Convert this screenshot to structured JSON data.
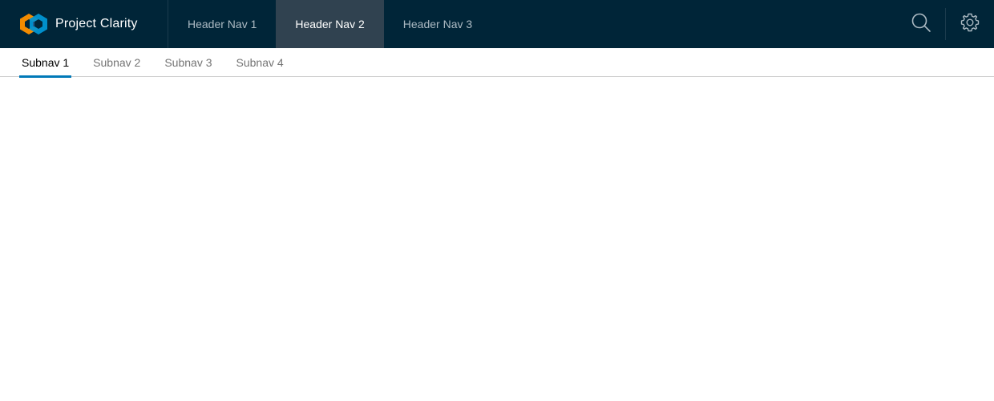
{
  "header": {
    "brand_title": "Project Clarity",
    "nav": [
      {
        "label": "Header Nav 1",
        "active": false
      },
      {
        "label": "Header Nav 2",
        "active": true
      },
      {
        "label": "Header Nav 3",
        "active": false
      }
    ],
    "actions": {
      "search_icon": "search-icon",
      "settings_icon": "gear-icon"
    },
    "colors": {
      "background": "#002538",
      "active_tab": "#304250",
      "logo_orange": "#f38b00",
      "logo_blue": "#0095d3"
    }
  },
  "subnav": {
    "tabs": [
      {
        "label": "Subnav 1",
        "active": true
      },
      {
        "label": "Subnav 2",
        "active": false
      },
      {
        "label": "Subnav 3",
        "active": false
      },
      {
        "label": "Subnav 4",
        "active": false
      }
    ],
    "accent_color": "#0079b8"
  }
}
